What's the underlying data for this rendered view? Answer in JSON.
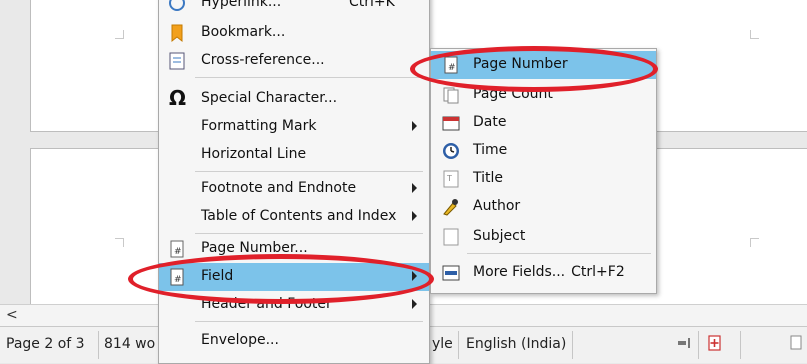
{
  "status_bar": {
    "page": "Page 2 of 3",
    "words": "814 wo",
    "style": "yle",
    "language": "English (India)"
  },
  "menu": {
    "items": [
      {
        "label": "Hyperlink...",
        "shortcut": "Ctrl+K",
        "icon": "hyperlink-icon"
      },
      {
        "label": "Bookmark...",
        "icon": "bookmark-icon"
      },
      {
        "label": "Cross-reference...",
        "icon": "cross-reference-icon"
      },
      {
        "label": "Special Character...",
        "icon": "omega-icon"
      },
      {
        "label": "Formatting Mark",
        "submenu": true
      },
      {
        "label": "Horizontal Line"
      },
      {
        "label": "Footnote and Endnote",
        "submenu": true
      },
      {
        "label": "Table of Contents and Index",
        "submenu": true
      },
      {
        "label": "Page Number...",
        "icon": "page-number-icon"
      },
      {
        "label": "Field",
        "submenu": true,
        "highlighted": true,
        "icon": "field-icon"
      },
      {
        "label": "Header and Footer",
        "submenu": true
      },
      {
        "label": "Envelope..."
      }
    ]
  },
  "submenu": {
    "items": [
      {
        "label": "Page Number",
        "highlighted": true,
        "icon": "page-number-icon"
      },
      {
        "label": "Page Count",
        "icon": "page-count-icon"
      },
      {
        "label": "Date",
        "icon": "date-icon"
      },
      {
        "label": "Time",
        "icon": "clock-icon"
      },
      {
        "label": "Title",
        "icon": "title-icon"
      },
      {
        "label": "Author",
        "icon": "author-icon"
      },
      {
        "label": "Subject",
        "icon": "subject-icon"
      },
      {
        "label": "More Fields...",
        "shortcut": "Ctrl+F2",
        "icon": "more-fields-icon"
      }
    ]
  },
  "colors": {
    "highlight": "#7cc3ea",
    "annotation": "#e0202a"
  }
}
